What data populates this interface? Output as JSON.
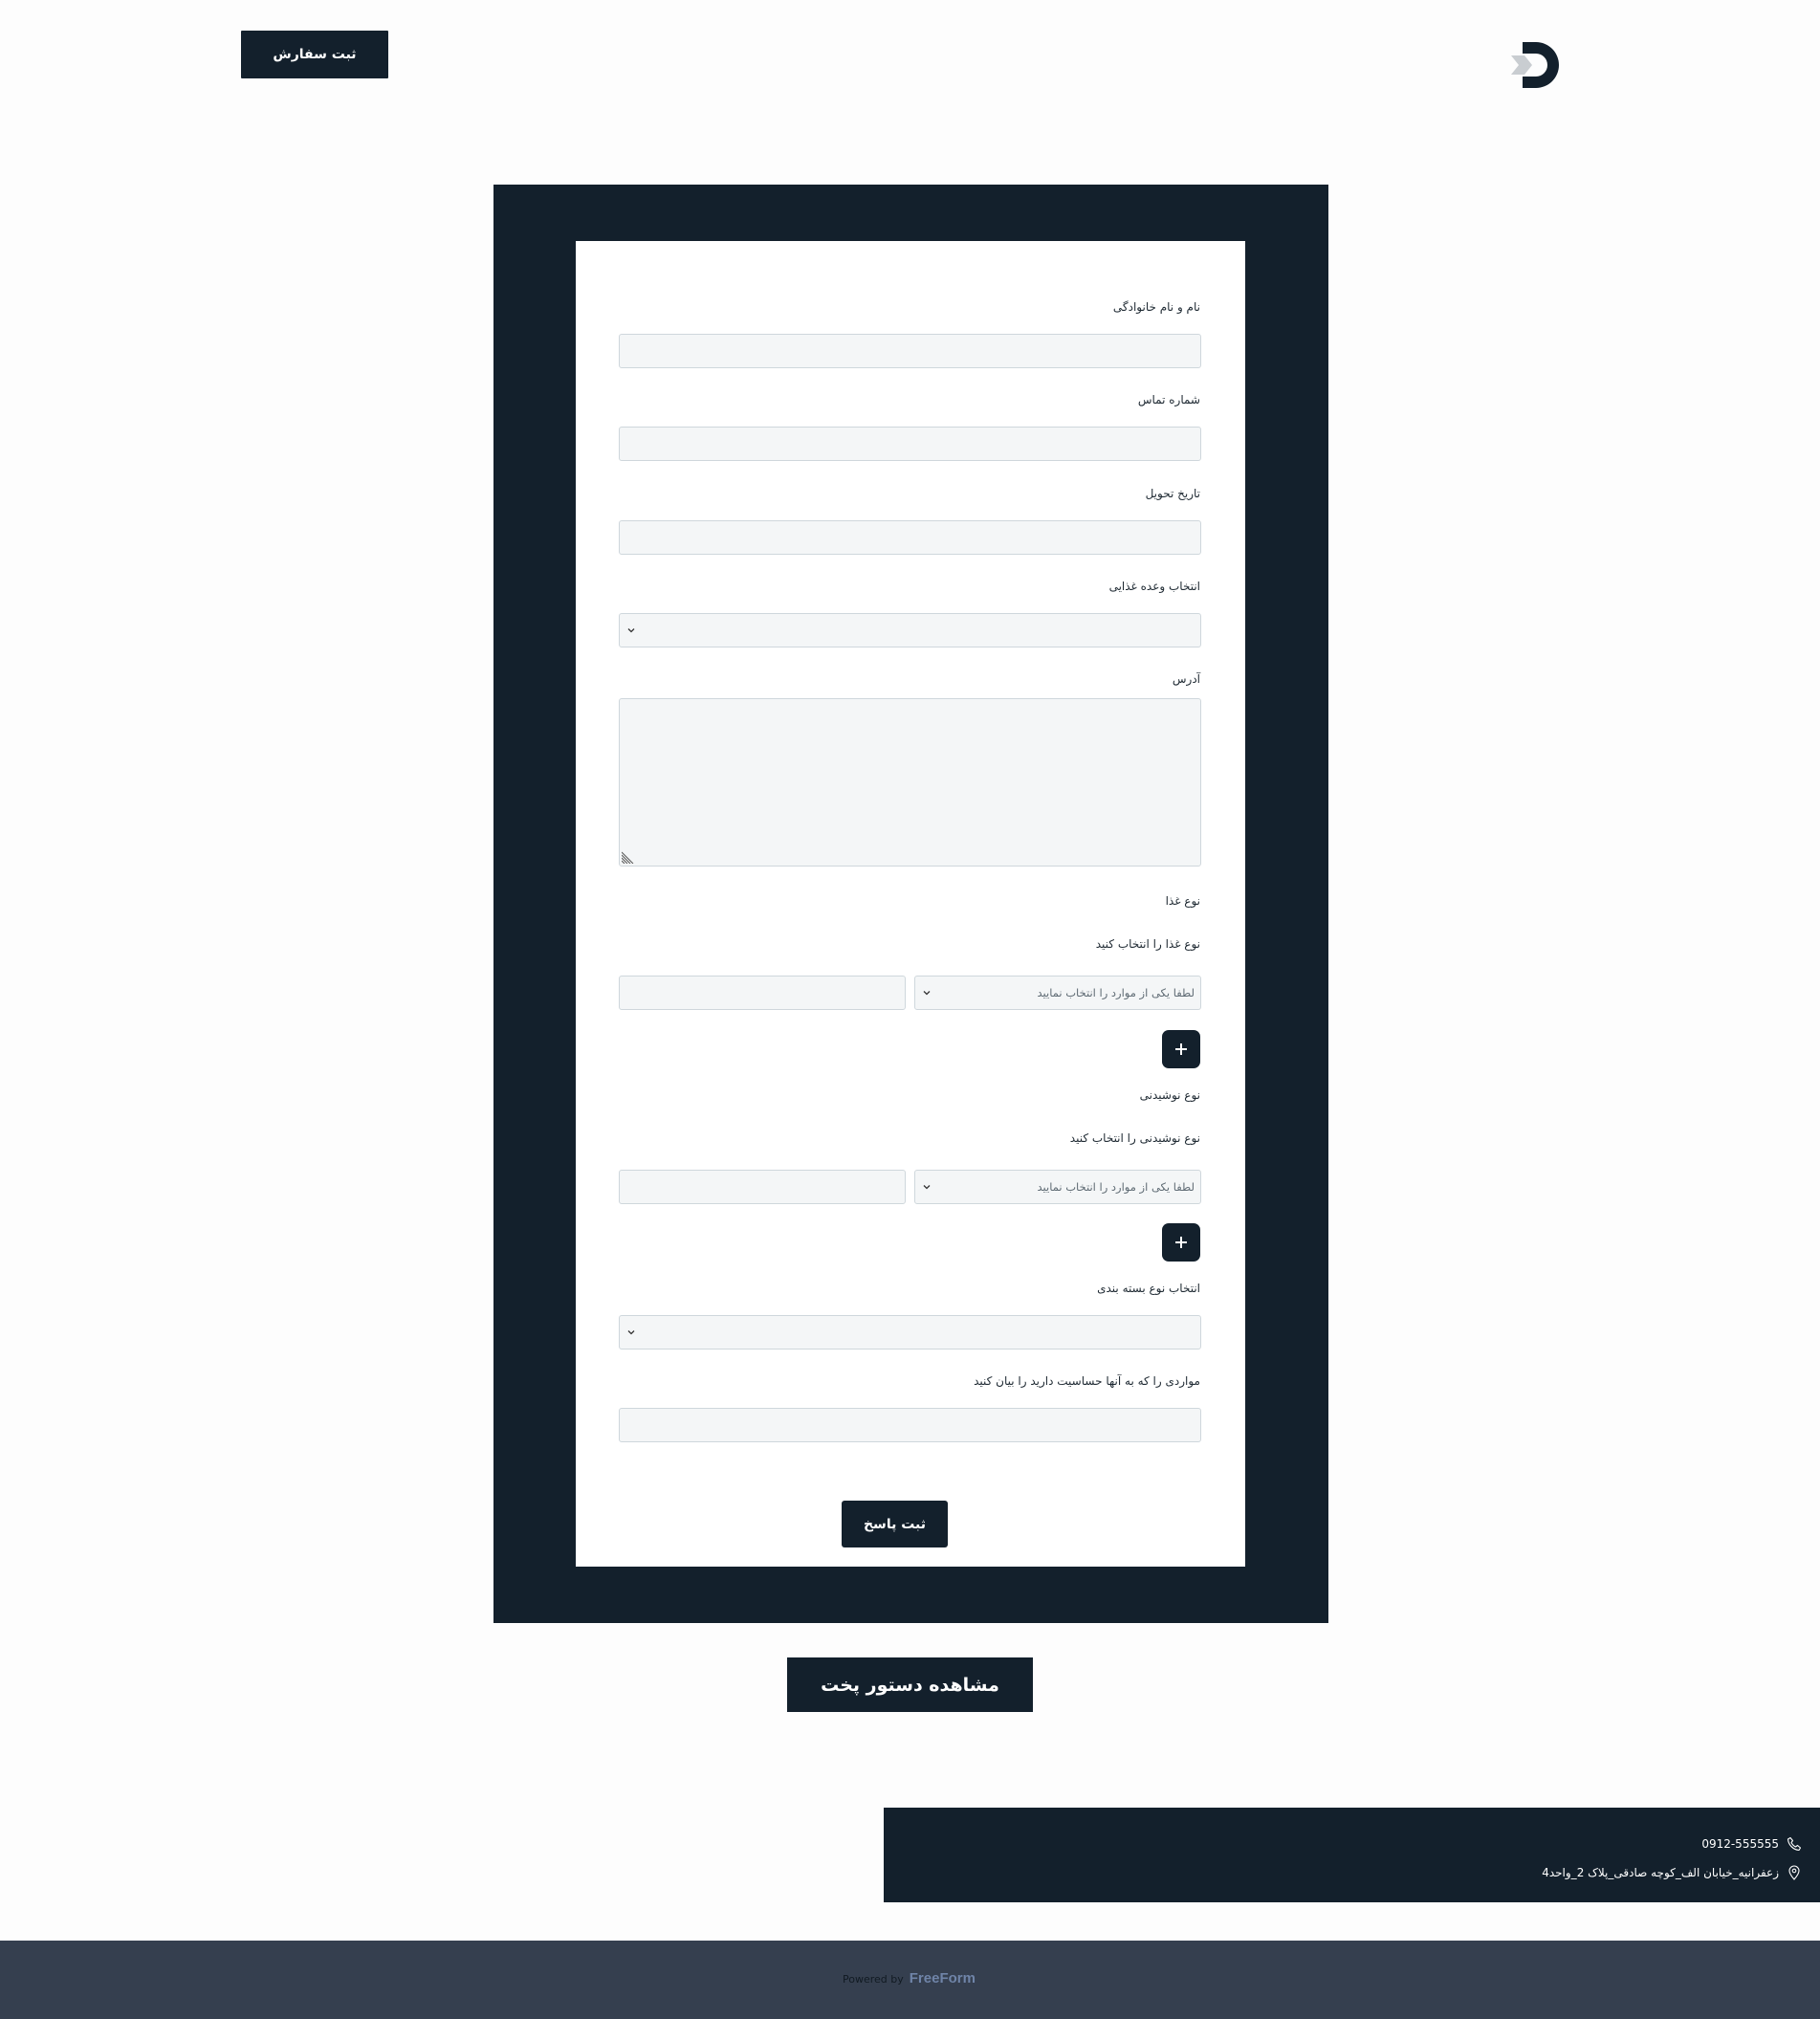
{
  "header": {
    "cta_label": "ثبت سفارش",
    "logo_icon": "brand-logo-icon"
  },
  "form": {
    "fields": {
      "full_name": {
        "label": "نام و نام خانوادگی",
        "value": ""
      },
      "phone": {
        "label": "شماره تماس",
        "value": ""
      },
      "delivery_date": {
        "label": "تاریخ تحویل",
        "value": ""
      },
      "meal": {
        "label": "انتخاب وعده غذایی",
        "selected": ""
      },
      "address": {
        "label": "آدرس",
        "value": ""
      },
      "food_type": {
        "label": "نوع غذا",
        "sublabel": "نوع غذا را انتخاب کنید",
        "select_placeholder": "لطفا یکی از موارد را انتخاب نمایید",
        "qty_value": ""
      },
      "drink_type": {
        "label": "نوع نوشیدنی",
        "sublabel": "نوع نوشیدنی را انتخاب کنید",
        "select_placeholder": "لطفا یکی از موارد را انتخاب نمایید",
        "qty_value": ""
      },
      "packaging": {
        "label": "انتخاب نوع بسته بندی",
        "selected": ""
      },
      "allergies": {
        "label": "مواردی را که به آنها حساسیت دارید را بیان کنید",
        "value": ""
      }
    },
    "submit_label": "ثبت پاسخ"
  },
  "recipe_button_label": "مشاهده دستور پخت",
  "contact": {
    "phone": "0912-555555",
    "address": "زعفرانیه_خیابان الف_کوچه صادقی_پلاک 2_واحد4"
  },
  "footer": {
    "powered_by": "Powered by",
    "brand": "FreeForm"
  },
  "colors": {
    "primary_dark": "#13202c",
    "footer_bg": "#353f4f",
    "field_bg": "#f4f6f7",
    "brand_accent": "#6f84a8"
  }
}
